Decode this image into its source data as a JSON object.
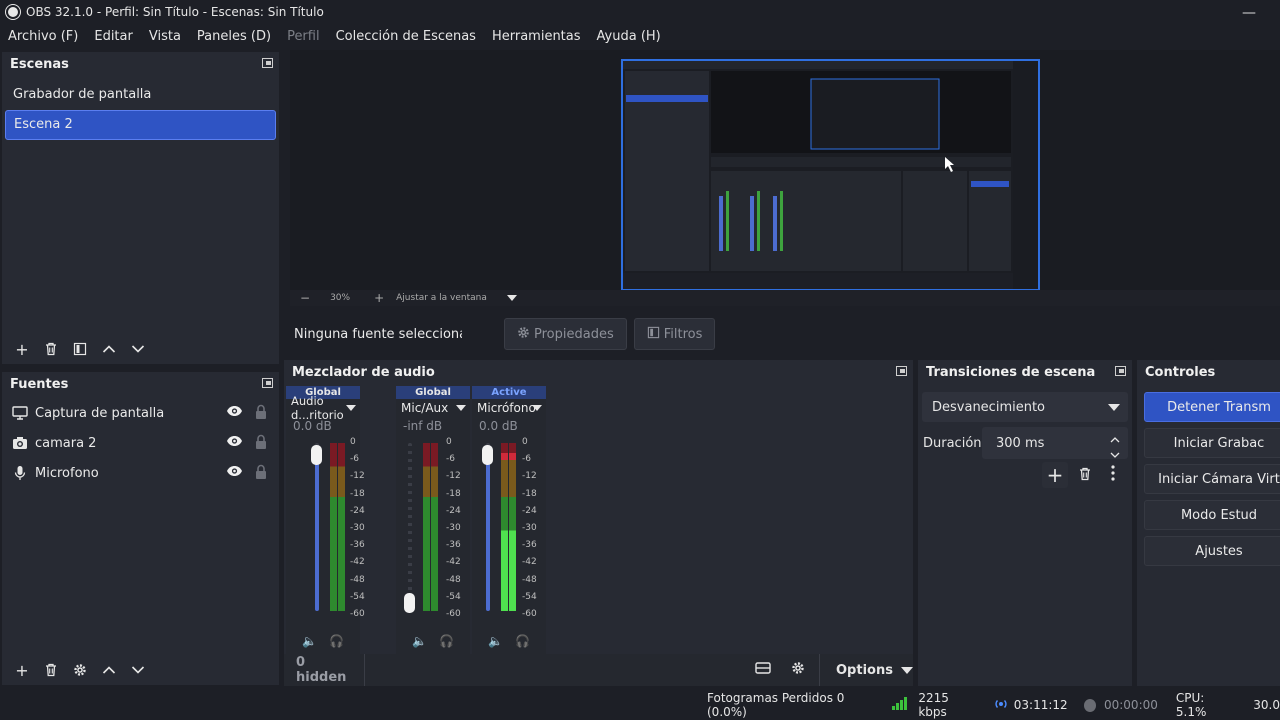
{
  "window": {
    "title": "OBS 32.1.0 - Perfil: Sin Título - Escenas: Sin Título"
  },
  "menu": [
    "Archivo (F)",
    "Editar",
    "Vista",
    "Paneles (D)",
    "Perfil",
    "Colección de Escenas",
    "Herramientas",
    "Ayuda (H)"
  ],
  "scenes": {
    "title": "Escenas",
    "items": [
      "Grabador de pantalla",
      "Escena 2"
    ],
    "selected": "Escena 2"
  },
  "sources": {
    "title": "Fuentes",
    "items": [
      {
        "label": "Captura de pantalla",
        "icon": "monitor-icon"
      },
      {
        "label": "camara 2",
        "icon": "camera-icon"
      },
      {
        "label": "Microfono",
        "icon": "microphone-icon"
      }
    ]
  },
  "preview": {
    "zoom": "30%",
    "fit": "Ajustar a la ventana"
  },
  "context": {
    "no_source": "Ninguna fuente seleccionada",
    "properties": "Propiedades",
    "filters": "Filtros"
  },
  "mixer": {
    "title": "Mezclador de audio",
    "channels": [
      {
        "badge": "Global",
        "name": "Audio d...ritorio",
        "db": "0.0 dB"
      },
      {
        "badge": "Global",
        "name": "Mic/Aux",
        "db": "-inf dB"
      },
      {
        "badge": "Active",
        "name": "Micrófono",
        "db": "0.0 dB"
      }
    ],
    "ticks": [
      "0",
      "-6",
      "-12",
      "-18",
      "-24",
      "-30",
      "-36",
      "-42",
      "-48",
      "-54",
      "-60"
    ],
    "hidden": "0 hidden",
    "options": "Options"
  },
  "transitions": {
    "title": "Transiciones de escena",
    "selected": "Desvanecimiento",
    "duration_label": "Duración",
    "duration_value": "300 ms"
  },
  "controls": {
    "title": "Controles",
    "buttons": [
      "Detener Transm",
      "Iniciar Grabac",
      "Iniciar Cámara Virt",
      "Modo Estud",
      "Ajustes"
    ]
  },
  "status": {
    "dropped": "Fotogramas Perdidos 0 (0.0%)",
    "bitrate": "2215 kbps",
    "stream_time": "03:11:12",
    "rec_time": "00:00:00",
    "cpu": "CPU: 5.1%",
    "fps": "30.0"
  },
  "colors": {
    "accent": "#2f54c4",
    "panel": "#272a33",
    "background": "#1d1f26"
  }
}
